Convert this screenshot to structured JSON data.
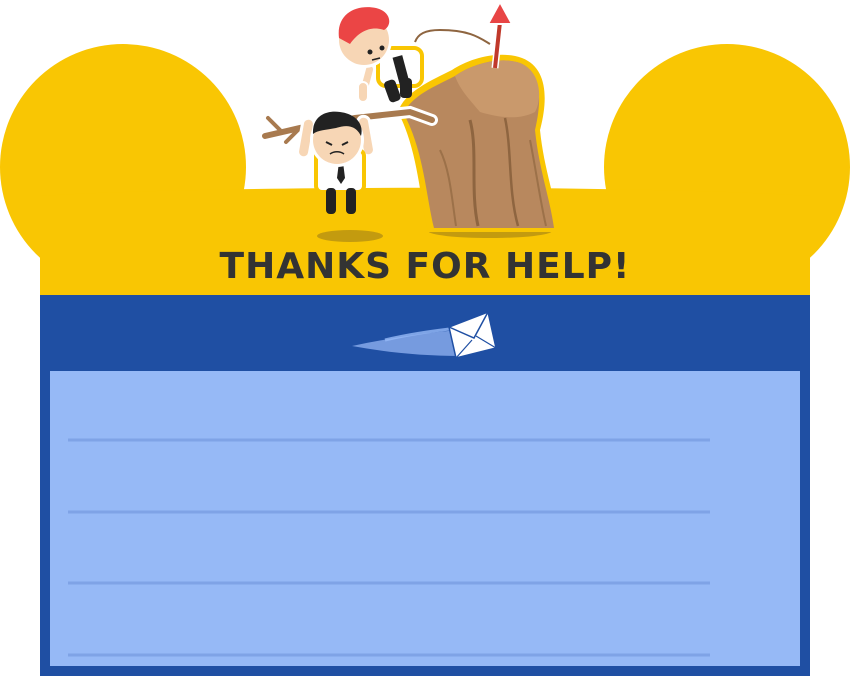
{
  "card": {
    "title": "THANKS FOR HELP!",
    "lines": 4
  },
  "colors": {
    "header_yellow": "#F9C603",
    "band_blue": "#1F4FA3",
    "panel_blue": "#96B9F6",
    "rule_blue": "#7FA3E6",
    "title_text": "#333333",
    "rock_brown": "#B8885E",
    "hair_red": "#EB4545"
  },
  "icons": {
    "envelope": "envelope-icon",
    "arrow": "arrow-up-icon"
  }
}
